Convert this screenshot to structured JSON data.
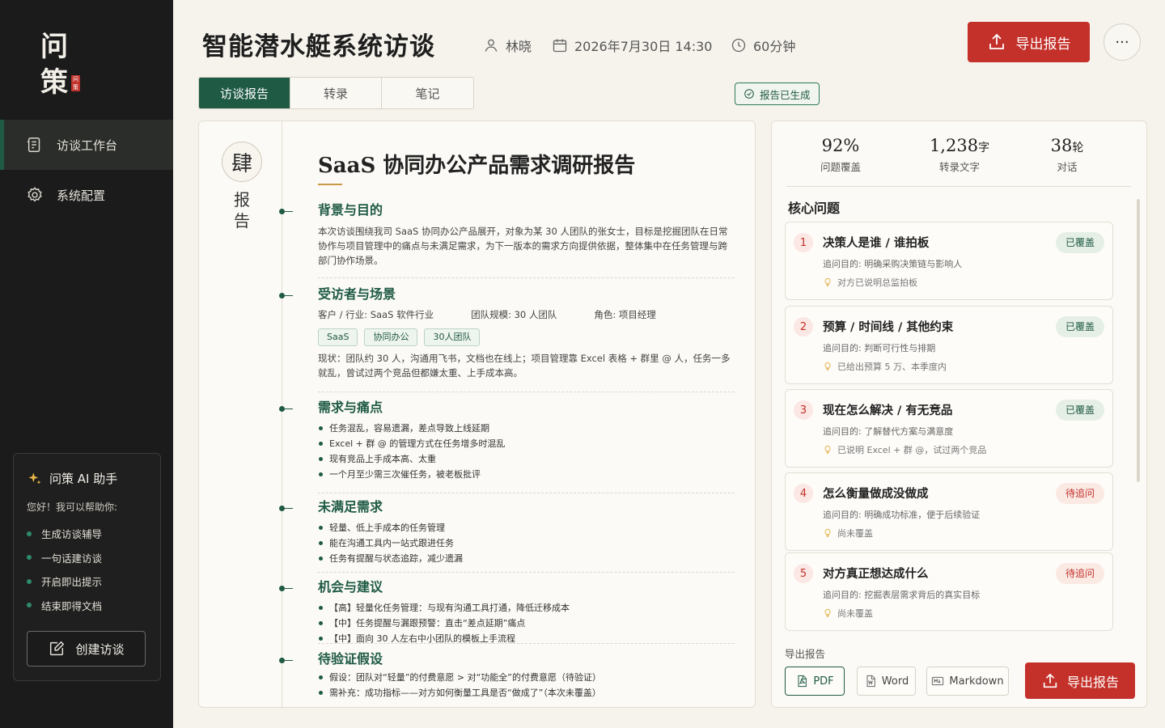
{
  "sidebar": {
    "logo_line1": "问",
    "logo_line2": "策",
    "logo_seal": "问策",
    "nav": [
      {
        "label": "访谈工作台",
        "icon": "document-icon",
        "active": true
      },
      {
        "label": "系统配置",
        "icon": "gear-icon",
        "active": false
      }
    ],
    "assistant": {
      "title": "问策 AI 助手",
      "greeting": "您好！我可以帮助你:",
      "items": [
        "生成访谈辅导",
        "一句话建访谈",
        "开启即出提示",
        "结束即得文档"
      ],
      "create_label": "创建访谈"
    }
  },
  "header": {
    "title": "智能潜水艇系统访谈",
    "interviewer": "林晓",
    "datetime": "2026年7月30日 14:30",
    "duration": "60分钟",
    "export_label": "导出报告",
    "more_label": "···"
  },
  "tabs": [
    {
      "label": "访谈报告",
      "active": true
    },
    {
      "label": "转录",
      "active": false
    },
    {
      "label": "笔记",
      "active": false
    }
  ],
  "status_badge": "报告已生成",
  "report": {
    "seal_char": "肆",
    "seal_vertical": "报告",
    "title": "SaaS 协同办公产品需求调研报告",
    "sections": {
      "background": {
        "heading": "背景与目的",
        "text": "本次访谈围绕我司 SaaS 协同办公产品展开，对象为某 30 人团队的张女士，目标是挖掘团队在日常协作与项目管理中的痛点与未满足需求，为下一版本的需求方向提供依据，整体集中在任务管理与跨部门协作场景。"
      },
      "interviewee": {
        "heading": "受访者与场景",
        "kv": [
          "客户 / 行业:  SaaS 软件行业",
          "团队规模:  30 人团队",
          "角色:  项目经理"
        ],
        "tags": [
          "SaaS",
          "协同办公",
          "30人团队"
        ],
        "text": "现状：团队约 30 人，沟通用飞书，文档也在线上；项目管理靠 Excel 表格 + 群里 @ 人，任务一多就乱，曾试过两个竞品但都嫌太重、上手成本高。"
      },
      "pain": {
        "heading": "需求与痛点",
        "items": [
          "任务混乱，容易遗漏，差点导致上线延期",
          "Excel + 群 @ 的管理方式在任务增多时混乱",
          "现有竞品上手成本高、太重",
          "一个月至少需三次催任务，被老板批评"
        ]
      },
      "unmet": {
        "heading": "未满足需求",
        "items": [
          "轻量、低上手成本的任务管理",
          "能在沟通工具内一站式跟进任务",
          "任务有提醒与状态追踪，减少遗漏"
        ]
      },
      "opportunity": {
        "heading": "机会与建议",
        "items": [
          "【高】轻量化任务管理：与现有沟通工具打通，降低迁移成本",
          "【中】任务提醒与漏跟预警：直击“差点延期”痛点",
          "【中】面向 30 人左右中小团队的模板上手流程"
        ]
      },
      "hypothesis": {
        "heading": "待验证假设",
        "items": [
          "假设：团队对“轻量”的付费意愿 > 对“功能全”的付费意愿（待验证）",
          "需补充：成功指标——对方如何衡量工具是否“做成了”（本次未覆盖）"
        ]
      }
    }
  },
  "stats": [
    {
      "value": "92%",
      "unit": "",
      "label": "问题覆盖"
    },
    {
      "value": "1,238",
      "unit": "字",
      "label": "转录文字"
    },
    {
      "value": "38",
      "unit": "轮",
      "label": "对话"
    }
  ],
  "core_questions": {
    "heading": "核心问题",
    "items": [
      {
        "num": "1",
        "title": "决策人是谁 / 谁拍板",
        "purpose": "追问目的:  明确采购决策链与影响人",
        "note": "对方已说明总监拍板",
        "status": "已覆盖",
        "covered": true
      },
      {
        "num": "2",
        "title": "预算 / 时间线 / 其他约束",
        "purpose": "追问目的:  判断可行性与排期",
        "note": "已给出预算 5 万、本季度内",
        "status": "已覆盖",
        "covered": true
      },
      {
        "num": "3",
        "title": "现在怎么解决 / 有无竞品",
        "purpose": "追问目的:  了解替代方案与满意度",
        "note": "已说明 Excel + 群 @，试过两个竞品",
        "status": "已覆盖",
        "covered": true
      },
      {
        "num": "4",
        "title": "怎么衡量做成没做成",
        "purpose": "追问目的:  明确成功标准，便于后续验证",
        "note": "尚未覆盖",
        "status": "待追问",
        "covered": false
      },
      {
        "num": "5",
        "title": "对方真正想达成什么",
        "purpose": "追问目的:  挖掘表层需求背后的真实目标",
        "note": "尚未覆盖",
        "status": "待追问",
        "covered": false
      }
    ]
  },
  "export": {
    "heading": "导出报告",
    "formats": [
      "PDF",
      "Word",
      "Markdown"
    ],
    "button_label": "导出报告"
  },
  "colors": {
    "primary_green": "#1f5a45",
    "accent_red": "#c4312a",
    "sidebar_bg": "#1b1b1b",
    "page_bg": "#f6f3ec"
  }
}
